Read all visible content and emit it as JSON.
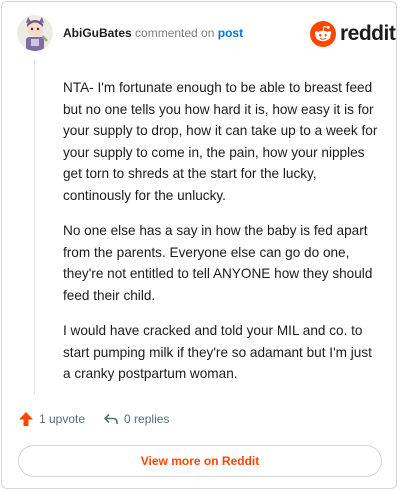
{
  "comment": {
    "username": "AbiGuBates",
    "action_text": "commented on",
    "post_link": "post",
    "brand": "reddit",
    "paragraphs": [
      "NTA- I'm fortunate enough to be able to breast feed but no one tells you how hard it is, how easy it is for your supply to drop, how it can take up to a week for your supply to come in, the pain, how your nipples get torn to shreds at the start for the lucky, continously for the unlucky.",
      "No one else has a say in how the baby is fed apart from the parents. Everyone else can go do one, they're not entitled to tell ANYONE how they should feed their child.",
      "I would have cracked and told your MIL and co. to start pumping milk if they're so adamant but I'm just a cranky postpartum woman."
    ]
  },
  "actions": {
    "upvotes": "1 upvote",
    "replies": "0 replies"
  },
  "footer": {
    "view_more": "View more on Reddit"
  },
  "colors": {
    "accent": "#ff4500",
    "link": "#0079d3"
  },
  "icons": {
    "upvote": "upvote-arrow-icon",
    "reply": "reply-arrow-icon",
    "brand": "reddit-snoo-icon"
  }
}
